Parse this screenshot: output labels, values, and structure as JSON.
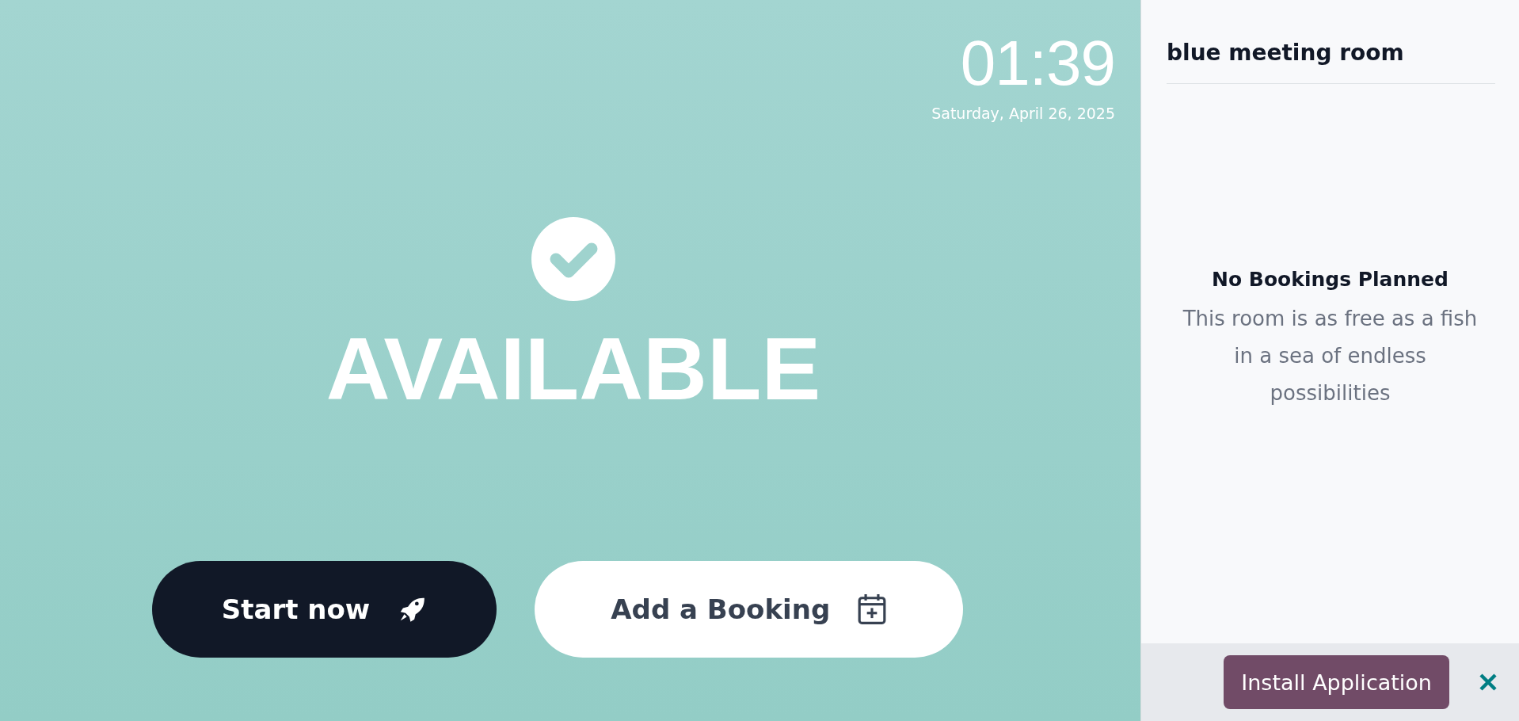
{
  "clock": {
    "time": "01:39",
    "date": "Saturday, April 26, 2025"
  },
  "status": {
    "kind": "available",
    "label": "AVAILABLE"
  },
  "actions": [
    {
      "kind": "primary",
      "label": "Start now"
    },
    {
      "kind": "secondary",
      "label": "Add a Booking"
    }
  ],
  "sidebar": {
    "room_name": "blue meeting room",
    "empty_state": {
      "title": "No Bookings Planned",
      "text": "This room is as free as a fish in a sea of endless possibilities"
    }
  },
  "install_bar": {
    "button": "Install Application"
  }
}
